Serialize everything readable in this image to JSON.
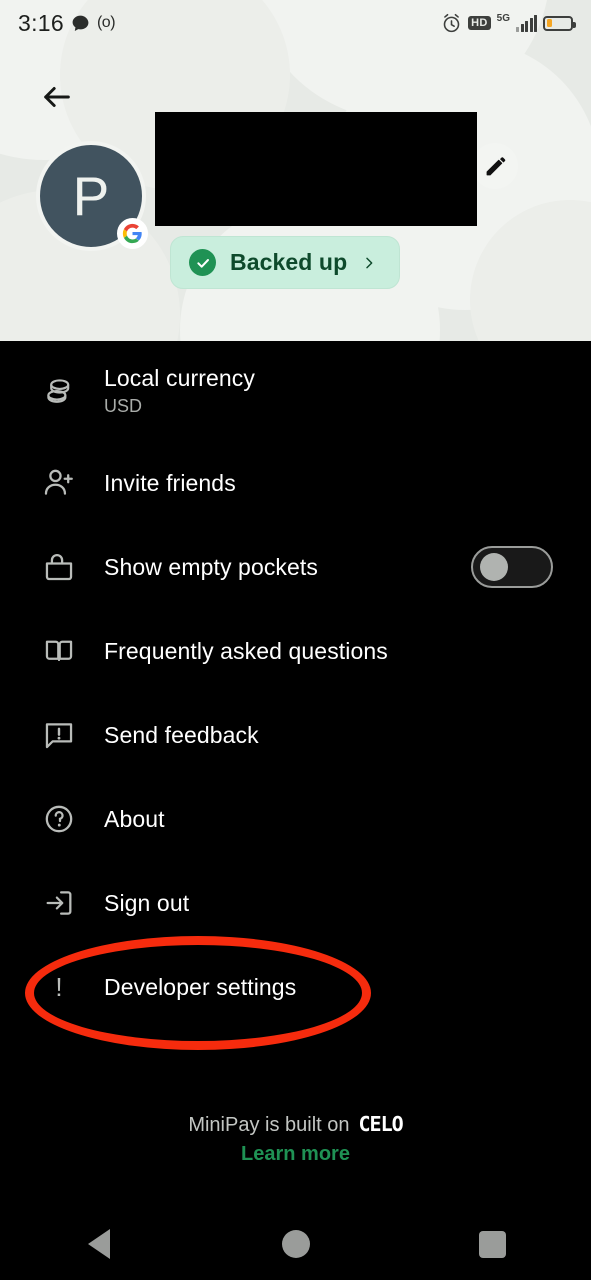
{
  "statusbar": {
    "time": "3:16",
    "message_icon": "speech-bubble-icon",
    "paren_text": "(o)",
    "alarm_icon": "alarm-clock-icon",
    "hd_label": "HD",
    "network_label": "5G",
    "signal_icon": "signal-bars-icon",
    "battery_icon": "battery-low-icon"
  },
  "header": {
    "back_icon": "back-arrow-icon",
    "edit_icon": "pencil-edit-icon",
    "avatar_initial": "P",
    "provider_badge": "google-g-icon",
    "name_redacted": "",
    "backed_up": {
      "label": "Backed up",
      "check_icon": "check-circle-icon",
      "chevron": "›"
    },
    "colors": {
      "background": "#e7eae6",
      "avatar_bg": "#41535f",
      "pill_bg": "#c9eedd",
      "pill_text": "#0e4a2c",
      "check_green": "#1f9254"
    }
  },
  "menu": {
    "items": [
      {
        "label": "Local currency",
        "sub": "USD",
        "icon": "coins-stack-icon",
        "control": "none"
      },
      {
        "label": "Invite friends",
        "sub": "",
        "icon": "person-add-icon",
        "control": "none"
      },
      {
        "label": "Show empty pockets",
        "sub": "",
        "icon": "pocket-bag-icon",
        "control": "toggle",
        "toggle_on": false
      },
      {
        "label": "Frequently asked questions",
        "sub": "",
        "icon": "open-book-icon",
        "control": "none"
      },
      {
        "label": "Send feedback",
        "sub": "",
        "icon": "feedback-bubble-icon",
        "control": "none"
      },
      {
        "label": "About",
        "sub": "",
        "icon": "question-circle-icon",
        "control": "none"
      },
      {
        "label": "Sign out",
        "sub": "",
        "icon": "sign-out-icon",
        "control": "none"
      },
      {
        "label": "Developer settings",
        "sub": "",
        "icon": "exclamation-icon",
        "control": "none",
        "highlighted": true
      }
    ]
  },
  "annotation": {
    "shape": "ellipse",
    "color": "#f62b0d",
    "targets": "Developer settings"
  },
  "footer": {
    "built_text": "MiniPay is built on",
    "brand": "CELO",
    "learn_more": "Learn more",
    "learn_more_color": "#1f9254"
  },
  "navbar": {
    "back": "nav-back-triangle-icon",
    "home": "nav-home-circle-icon",
    "recents": "nav-recents-square-icon"
  }
}
